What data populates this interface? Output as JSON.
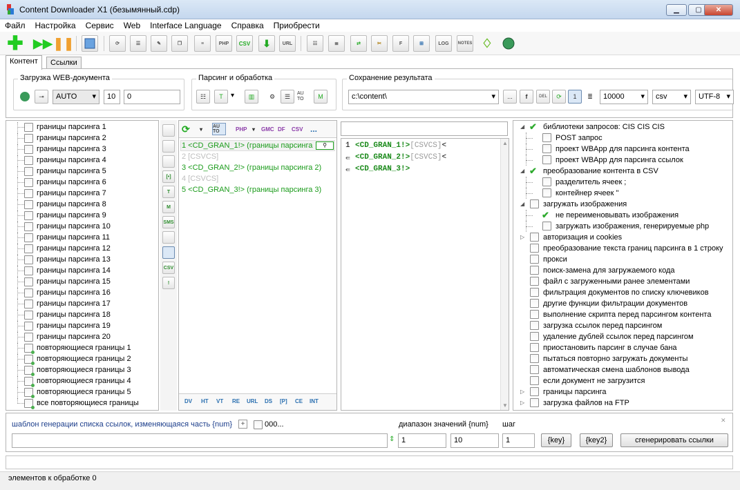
{
  "window": {
    "title": "Content Downloader X1 (безымянный.cdp)",
    "minimize": "▁",
    "maximize": "▢",
    "close": "✕"
  },
  "menu": [
    "Файл",
    "Настройка",
    "Сервис",
    "Web",
    "Interface Language",
    "Справка",
    "Приобрести"
  ],
  "toolbar_icons": [
    "add-icon",
    "play-icon",
    "pause-icon",
    "preview-icon",
    "refresh-page-icon",
    "users-icon",
    "edit-icon",
    "copy-icon",
    "lines-icon",
    "php-icon",
    "csv-icon",
    "download-icon",
    "url-icon",
    "settings-icon",
    "list-icon",
    "import-icon",
    "tools-icon",
    "file-icon",
    "tree-icon",
    "log-icon",
    "notes-icon",
    "bulb-icon",
    "globe-icon"
  ],
  "toolbar_text": {
    "php": "PHP",
    "csv": "CSV",
    "url": "URL",
    "log": "LOG",
    "notes": "NOTES"
  },
  "tabs": {
    "content": "Контент",
    "links": "Ссылки"
  },
  "load_group": {
    "label": "Загрузка WEB-документа",
    "mode": "AUTO",
    "threads": "10",
    "delay": "0"
  },
  "parse_group": {
    "label": "Парсинг и обработка",
    "auto_text": "AU TO",
    "t_text": "T",
    "m_text": "M"
  },
  "save_group": {
    "label": "Сохранение результата",
    "path": "c:\\content\\",
    "browse": "...",
    "f_text": "f",
    "del_text": "DEL",
    "one_text": "1",
    "limit": "10000",
    "format": "csv",
    "encoding": "UTF-8"
  },
  "left_list": [
    "границы парсинга 1",
    "границы парсинга 2",
    "границы парсинга 3",
    "границы парсинга 4",
    "границы парсинга 5",
    "границы парсинга 6",
    "границы парсинга 7",
    "границы парсинга 8",
    "границы парсинга 9",
    "границы парсинга 10",
    "границы парсинга 11",
    "границы парсинга 12",
    "границы парсинга 13",
    "границы парсинга 14",
    "границы парсинга 15",
    "границы парсинга 16",
    "границы парсинга 17",
    "границы парсинга 18",
    "границы парсинга 19",
    "границы парсинга 20",
    "повторяющиеся границы 1",
    "повторяющиеся границы 2",
    "повторяющиеся границы 3",
    "повторяющиеся границы 4",
    "повторяющиеся границы 5",
    "все повторяющиеся границы"
  ],
  "vbar_text": [
    "",
    "",
    "",
    "[•]",
    "T",
    "M",
    "SMS",
    "",
    "",
    "CSV",
    "!"
  ],
  "parse_toolbar": {
    "auto": "AU TO",
    "php": "PHP",
    "gmc": "GMC",
    "df": "DF",
    "csv": "CSV",
    "more": "..."
  },
  "parse_lines": [
    {
      "text": "1 <CD_GRAN_1!> (границы парсинга",
      "style": "green"
    },
    {
      "text": "2 [CSVCS]",
      "style": "gray"
    },
    {
      "text": "3 <CD_GRAN_2!> (границы парсинга 2)",
      "style": "green"
    },
    {
      "text": "4 [CSVCS]",
      "style": "gray"
    },
    {
      "text": "5 <CD_GRAN_3!> (границы парсинга 3)",
      "style": "green"
    }
  ],
  "parse_footer": [
    "DV",
    "HT",
    "VT",
    "RE",
    "URL",
    "DS",
    "[P]",
    "CE",
    "INT"
  ],
  "code_lines": [
    {
      "num": "1",
      "tag": "<CD_GRAN_1!>",
      "tail": "[CSVCS]",
      "end": "<"
    },
    {
      "num": "",
      "tag": "<CD_GRAN_2!>",
      "tail": "[CSVCS]",
      "end": "<"
    },
    {
      "num": "",
      "tag": "<CD_GRAN_3!>",
      "tail": "",
      "end": ""
    }
  ],
  "right_tree": [
    {
      "label": "библиотеки запросов: CIS CIS CIS",
      "level": 0,
      "expand": "◢",
      "checked": true
    },
    {
      "label": "POST запрос",
      "level": 1,
      "expand": "",
      "checked": false
    },
    {
      "label": "проект WBApp для парсинга контента",
      "level": 1,
      "expand": "",
      "checked": false
    },
    {
      "label": "проект WBApp для парсинга ссылок",
      "level": 1,
      "expand": "",
      "checked": false
    },
    {
      "label": "преобразование контента в CSV",
      "level": 0,
      "expand": "◢",
      "checked": true
    },
    {
      "label": "разделитель ячеек ;",
      "level": 1,
      "expand": "",
      "checked": false
    },
    {
      "label": "контейнер ячеек \"",
      "level": 1,
      "expand": "",
      "checked": false
    },
    {
      "label": "загружать изображения",
      "level": 0,
      "expand": "◢",
      "checked": false
    },
    {
      "label": "не переименовывать изображения",
      "level": 1,
      "expand": "",
      "checked": true
    },
    {
      "label": "загружать изображения, генерируемые php",
      "level": 1,
      "expand": "",
      "checked": false
    },
    {
      "label": "авторизация и cookies",
      "level": 0,
      "expand": "▷",
      "checked": false
    },
    {
      "label": "преобразование текста границ парсинга в 1 строку",
      "level": 0,
      "expand": "",
      "checked": false
    },
    {
      "label": "прокси",
      "level": 0,
      "expand": "",
      "checked": false
    },
    {
      "label": "поиск-замена для загружаемого кода",
      "level": 0,
      "expand": "",
      "checked": false
    },
    {
      "label": "файл с загруженными ранее элементами",
      "level": 0,
      "expand": "",
      "checked": false
    },
    {
      "label": "фильтрация документов по списку ключевиков",
      "level": 0,
      "expand": "",
      "checked": false
    },
    {
      "label": "другие функции фильтрации документов",
      "level": 0,
      "expand": "",
      "checked": false
    },
    {
      "label": "выполнение скрипта перед парсингом контента",
      "level": 0,
      "expand": "",
      "checked": false
    },
    {
      "label": "загрузка ссылок перед парсингом",
      "level": 0,
      "expand": "",
      "checked": false
    },
    {
      "label": "удаление дублей ссылок перед парсингом",
      "level": 0,
      "expand": "",
      "checked": false
    },
    {
      "label": "приостановить парсинг в случае бана",
      "level": 0,
      "expand": "",
      "checked": false
    },
    {
      "label": "пытаться повторно загружать документы",
      "level": 0,
      "expand": "",
      "checked": false
    },
    {
      "label": "автоматическая смена шаблонов вывода",
      "level": 0,
      "expand": "",
      "checked": false
    },
    {
      "label": "если документ не загрузится",
      "level": 0,
      "expand": "",
      "checked": false
    },
    {
      "label": "границы парсинга",
      "level": 0,
      "expand": "▷",
      "checked": false
    },
    {
      "label": "загрузка файлов на FTP",
      "level": 0,
      "expand": "▷",
      "checked": false
    }
  ],
  "generator": {
    "template_label": "шаблон генерации списка ссылок, изменяющаяся часть {num}",
    "plus": "+",
    "zeros_label": "000...",
    "range_label": "диапазон значений {num}",
    "step_label": "шаг",
    "from": "1",
    "to": "10",
    "step": "1",
    "key_btn": "{key}",
    "key2_btn": "{key2}",
    "generate_btn": "сгенерировать ссылки",
    "close": "✕"
  },
  "status": {
    "text": "элементов к обработке 0"
  }
}
